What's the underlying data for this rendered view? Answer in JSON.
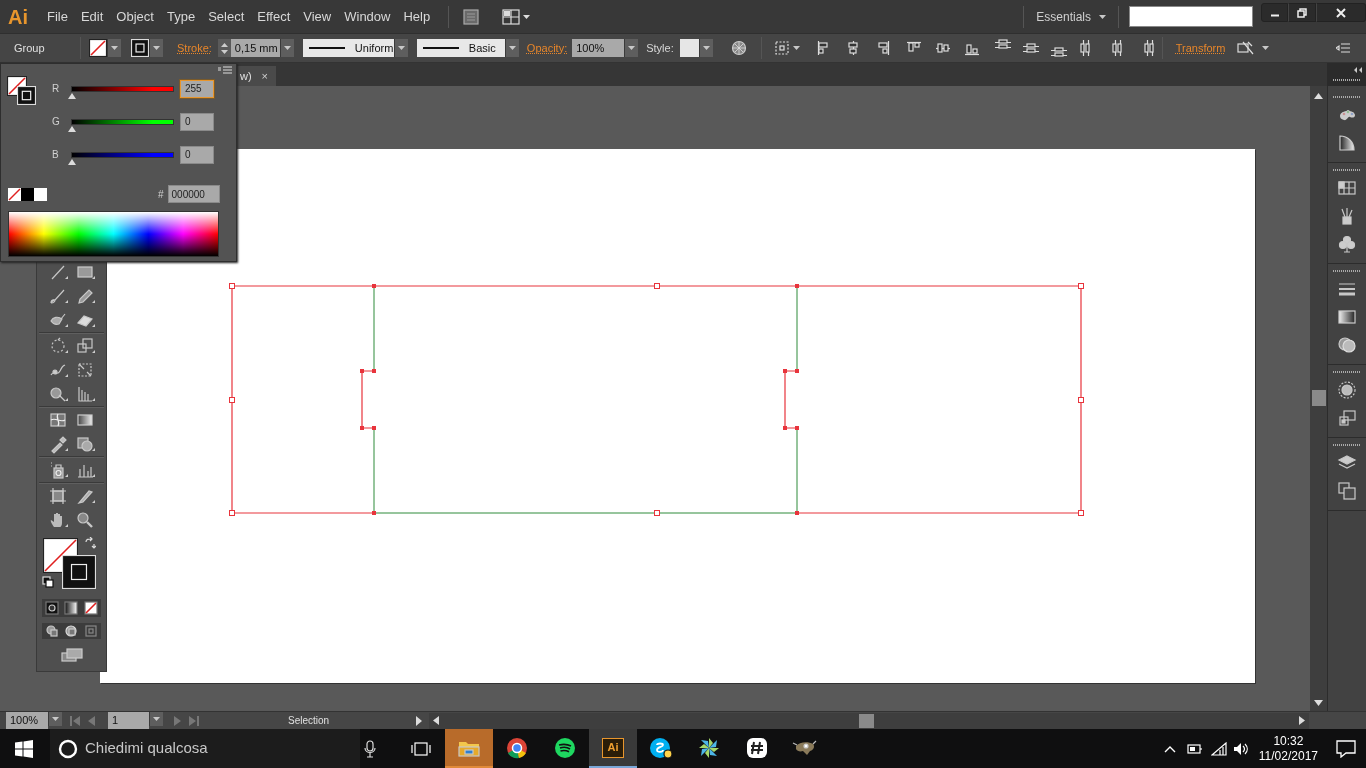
{
  "app_logo": "Ai",
  "menu": [
    "File",
    "Edit",
    "Object",
    "Type",
    "Select",
    "Effect",
    "View",
    "Window",
    "Help"
  ],
  "workspace": "Essentials",
  "control_bar": {
    "selection": "Group",
    "stroke_label": "Stroke:",
    "stroke_weight": "0,15 mm",
    "profile": "Uniform",
    "brush": "Basic",
    "opacity_label": "Opacity:",
    "opacity": "100%",
    "style_label": "Style:",
    "transform_label": "Transform"
  },
  "document_tab": {
    "title": "w)",
    "close": "×"
  },
  "color_panel": {
    "channels": [
      {
        "label": "R",
        "value": "255",
        "level": 0,
        "focused": true,
        "color": "#ff0000"
      },
      {
        "label": "G",
        "value": "0",
        "level": 0,
        "focused": false,
        "color": "#00ff00"
      },
      {
        "label": "B",
        "value": "0",
        "level": 0,
        "focused": false,
        "color": "#0000ff"
      }
    ],
    "hex_label": "#",
    "hex": "000000"
  },
  "status_bar": {
    "zoom": "100%",
    "artboard": "1",
    "tool": "Selection"
  },
  "taskbar": {
    "search_placeholder": "Chiedimi qualcosa",
    "apps": [
      {
        "kind": "folder",
        "flashing": true,
        "selected": false
      },
      {
        "kind": "browser",
        "flashing": false,
        "selected": false
      },
      {
        "kind": "music",
        "flashing": false,
        "selected": false
      },
      {
        "kind": "illustrator",
        "label": "Ai",
        "flashing": false,
        "selected": true
      },
      {
        "kind": "chat",
        "flashing": false,
        "selected": false
      },
      {
        "kind": "pinwheel",
        "flashing": false,
        "selected": false
      },
      {
        "kind": "hash",
        "flashing": false,
        "selected": false
      },
      {
        "kind": "animal",
        "flashing": false,
        "selected": false
      }
    ],
    "time": "10:32",
    "date": "11/02/2017"
  }
}
